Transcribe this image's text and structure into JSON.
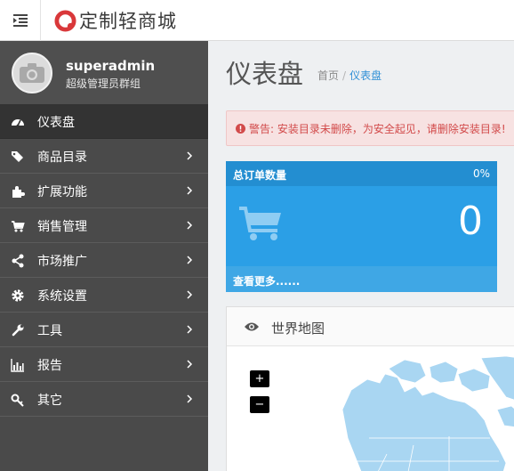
{
  "header": {
    "brand_text": "定制轻商城",
    "icons": {
      "menu_toggle": "menu-indent-icon",
      "brand": "logo-mark-icon"
    }
  },
  "profile": {
    "username": "superadmin",
    "group": "超级管理员群组",
    "avatar_icon": "camera-icon"
  },
  "sidebar": {
    "items": [
      {
        "label": "仪表盘",
        "icon": "dashboard-icon",
        "active": true,
        "has_children": false
      },
      {
        "label": "商品目录",
        "icon": "tags-icon",
        "active": false,
        "has_children": true
      },
      {
        "label": "扩展功能",
        "icon": "puzzle-icon",
        "active": false,
        "has_children": true
      },
      {
        "label": "销售管理",
        "icon": "cart-icon",
        "active": false,
        "has_children": true
      },
      {
        "label": "市场推广",
        "icon": "share-icon",
        "active": false,
        "has_children": true
      },
      {
        "label": "系统设置",
        "icon": "gear-icon",
        "active": false,
        "has_children": true
      },
      {
        "label": "工具",
        "icon": "wrench-icon",
        "active": false,
        "has_children": true
      },
      {
        "label": "报告",
        "icon": "bar-chart-icon",
        "active": false,
        "has_children": true
      },
      {
        "label": "其它",
        "icon": "key-icon",
        "active": false,
        "has_children": true
      }
    ]
  },
  "main": {
    "title": "仪表盘",
    "breadcrumb": {
      "home": "首页",
      "separator": "/",
      "current": "仪表盘"
    },
    "alert": {
      "text": "警告: 安装目录未删除，为安全起见，请删除安装目录!",
      "icon": "exclamation-circle-icon"
    },
    "order_tile": {
      "title": "总订单数量",
      "percent": "0%",
      "value": "0",
      "more": "查看更多......",
      "icon": "cart-icon"
    },
    "map_panel": {
      "title": "世界地图",
      "icon": "eye-icon",
      "zoom_in": "+",
      "zoom_out": "−"
    }
  },
  "colors": {
    "sidebar_bg": "#4a4a4a",
    "sidebar_active": "#333333",
    "tile_blue": "#2b9fe6",
    "tile_head": "#238ed1",
    "alert_text": "#d24a4a",
    "accent_link": "#2f8fd6",
    "map_fill": "#a9d6f2",
    "brand_red": "#d9383a"
  }
}
